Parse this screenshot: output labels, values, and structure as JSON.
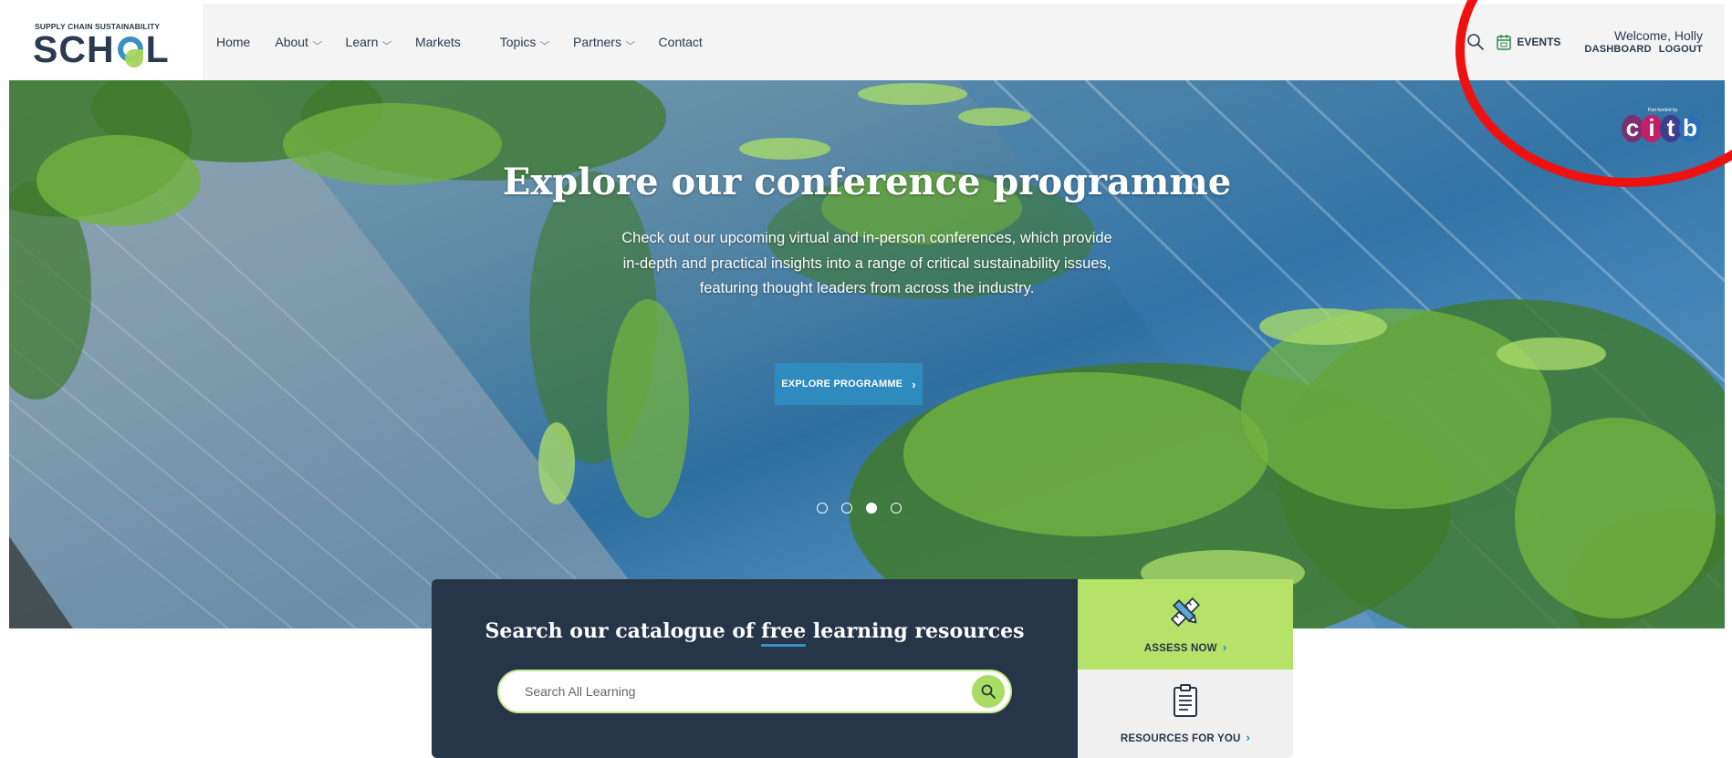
{
  "brand": {
    "tagline": "SUPPLY CHAIN SUSTAINABILITY",
    "name_part1": "SCH",
    "name_part2": "L"
  },
  "nav": {
    "items": [
      {
        "label": "Home",
        "has_dropdown": false
      },
      {
        "label": "About",
        "has_dropdown": true
      },
      {
        "label": "Learn",
        "has_dropdown": true
      },
      {
        "label": "Markets",
        "has_dropdown": false
      },
      {
        "label": "Topics",
        "has_dropdown": true
      },
      {
        "label": "Partners",
        "has_dropdown": true
      },
      {
        "label": "Contact",
        "has_dropdown": false
      }
    ]
  },
  "header": {
    "search_icon": "search-icon",
    "events_label": "EVENTS",
    "events_icon": "calendar-icon",
    "welcome": "Welcome, Holly",
    "dashboard_label": "DASHBOARD",
    "logout_label": "LOGOUT"
  },
  "hero": {
    "funded_text": "Part funded by",
    "citb_letters": [
      "c",
      "i",
      "t",
      "b"
    ],
    "title": "Explore our conference programme",
    "text": "Check out our upcoming virtual and in-person conferences, which provide in-depth and practical insights into a range of critical sustainability issues, featuring thought leaders from across the industry.",
    "button_label": "EXPLORE PROGRAMME",
    "slides": 4,
    "active_slide": 3
  },
  "search": {
    "title_before": "Search our catalogue of ",
    "title_emph": "free",
    "title_after": " learning resources",
    "placeholder": "Search All Learning"
  },
  "tiles": {
    "assess_label": "ASSESS NOW",
    "assess_icon": "ruler-pencil-icon",
    "resources_label": "RESOURCES FOR YOU",
    "resources_icon": "clipboard-icon"
  },
  "colors": {
    "navy": "#263548",
    "accent_blue": "#2f8bbd",
    "accent_green": "#b5e269",
    "annotation_red": "#ee1111"
  }
}
